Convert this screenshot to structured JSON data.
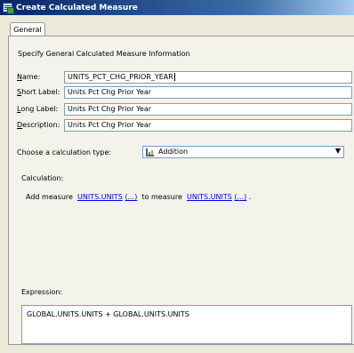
{
  "window": {
    "title": "Create Calculated Measure",
    "icon": "measure-icon"
  },
  "tabs": [
    {
      "label": "General",
      "selected": true
    }
  ],
  "general": {
    "instructions": "Specify General Calculated Measure Information",
    "fields": {
      "name": {
        "label_ul": "N",
        "label_rest": "ame:",
        "value": "UNITS_PCT_CHG_PRIOR_YEAR"
      },
      "short_label": {
        "label_ul": "S",
        "label_rest": "hort Label:",
        "value": "Units Pct Chg Prior Year"
      },
      "long_label": {
        "label_ul": "L",
        "label_rest": "ong Label:",
        "value": "Units Pct Chg Prior Year"
      },
      "description": {
        "label_ul": "D",
        "label_rest": "escription:",
        "value": "Units Pct Chg Prior Year"
      }
    },
    "calc_type": {
      "label": "Choose a calculation type:",
      "value": "Addition",
      "icon": "addition-icon"
    },
    "calculation": {
      "heading": "Calculation:",
      "text_add": "Add measure",
      "measure1": "UNITS.UNITS",
      "measure1_more": "(...)",
      "text_to": "to measure",
      "measure2": "UNITS.UNITS",
      "measure2_more": "(...)",
      "text_end": "."
    },
    "expression": {
      "heading": "Expression:",
      "value": "GLOBAL.UNITS.UNITS + GLOBAL.UNITS.UNITS"
    }
  }
}
